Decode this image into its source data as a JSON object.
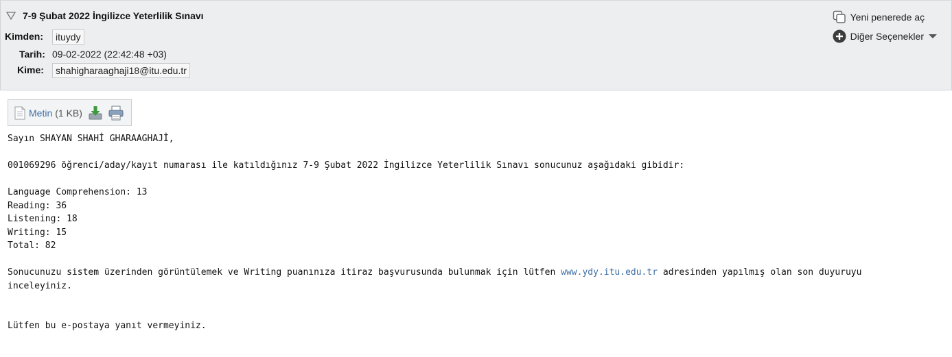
{
  "header": {
    "subject": "7-9 Şubat 2022 İngilizce Yeterlilik Sınavı",
    "from_label": "Kimden:",
    "from_value": "ituydy",
    "date_label": "Tarih:",
    "date_value": "09-02-2022 (22:42:48 +03)",
    "to_label": "Kime:",
    "to_value": "shahigharaaghaji18@itu.edu.tr"
  },
  "actions": {
    "new_window": "Yeni penerede aç",
    "more_options": "Diğer Seçenekler"
  },
  "attachment": {
    "name": "Metin",
    "size": "(1 KB)"
  },
  "body": {
    "greeting": "Sayın SHAYAN SHAHİ GHARAAGHAJİ,",
    "intro": "001069296 öğrenci/aday/kayıt numarası ile katıldığınız 7-9 Şubat 2022 İngilizce Yeterlilik Sınavı sonucunuz aşağıdaki gibidir:",
    "scores": [
      "Language Comprehension: 13",
      "Reading: 36",
      "Listening: 18",
      "Writing: 15",
      "Total: 82"
    ],
    "info_before_link": "Sonucunuzu sistem üzerinden görüntülemek ve Writing puanınıza itiraz başvurusunda bulunmak için lütfen ",
    "link": "www.ydy.itu.edu.tr",
    "info_after_link": " adresinden yapılmış olan son duyuruyu inceleyiniz.",
    "closing": "Lütfen bu e-postaya yanıt vermeyiniz."
  },
  "colors": {
    "header_bg": "#eceeef",
    "link": "#3d6ea5"
  }
}
